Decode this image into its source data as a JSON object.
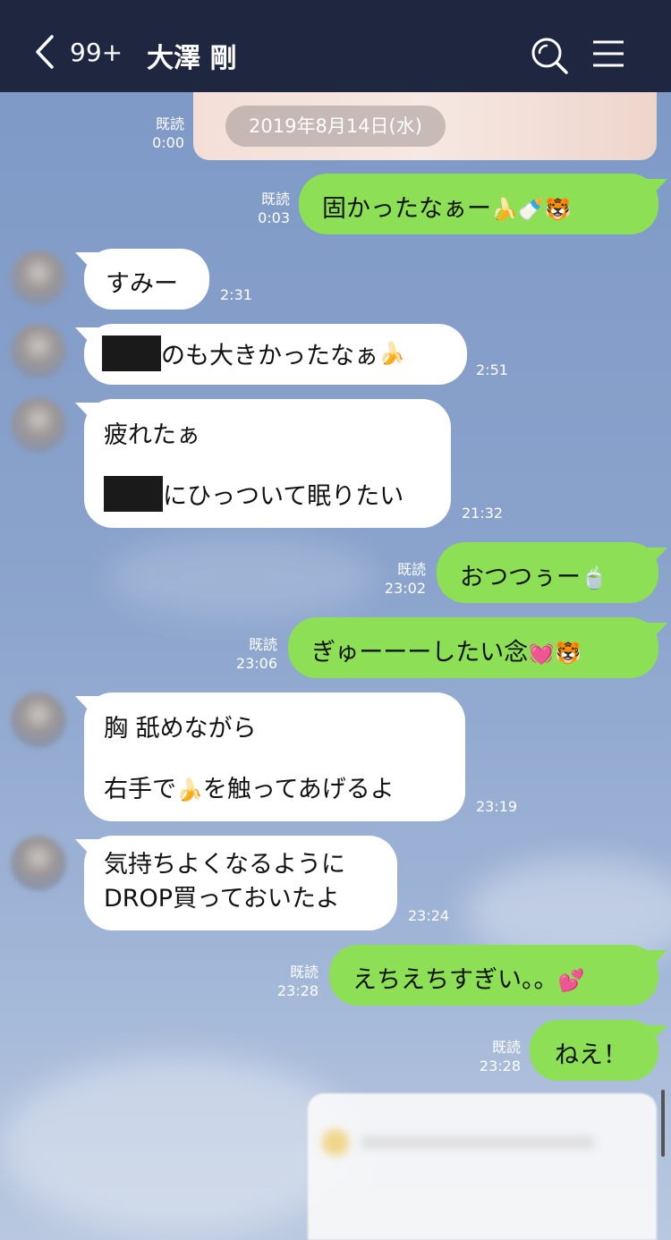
{
  "header": {
    "unread_count": "99+",
    "chat_name": "大澤 剛",
    "back_icon": "chevron-left-icon",
    "search_icon": "search-icon",
    "menu_icon": "hamburger-menu-icon"
  },
  "date_separator": "2019年8月14日(水)",
  "messages": [
    {
      "side": "right",
      "read": "既読",
      "time": "0:00",
      "type": "image"
    },
    {
      "side": "right",
      "read": "既読",
      "time": "0:03",
      "text": "固かったなぁー",
      "emoji": "🍌🍼🐯"
    },
    {
      "side": "left",
      "time": "2:31",
      "text": "すみー"
    },
    {
      "side": "left",
      "time": "2:51",
      "text": "のも大きかったなぁ",
      "emoji": "🍌"
    },
    {
      "side": "left",
      "time": "21:32",
      "line1": "疲れたぁ",
      "line2": "にひっついて眠りたい"
    },
    {
      "side": "right",
      "read": "既読",
      "time": "23:02",
      "text": "おつつぅー",
      "emoji": "🍵"
    },
    {
      "side": "right",
      "read": "既読",
      "time": "23:06",
      "text": "ぎゅーーーしたい念",
      "emoji": "💓🐯"
    },
    {
      "side": "left",
      "time": "23:19",
      "line1": "胸 舐めながら",
      "line2a": "右手で",
      "emoji": "🍌",
      "line2b": "を触ってあげるよ"
    },
    {
      "side": "left",
      "time": "23:24",
      "line1": "気持ちよくなるように",
      "line2": "DROP買っておいたよ"
    },
    {
      "side": "right",
      "read": "既読",
      "time": "23:28",
      "text": "えちえちすぎい。。",
      "emoji": "💕"
    },
    {
      "side": "right",
      "read": "既読",
      "time": "23:28",
      "text": "ねえ！"
    }
  ],
  "colors": {
    "header_bg": "#1f2740",
    "sent_bubble": "#8de055",
    "received_bubble": "#ffffff",
    "chat_bg": "#8aa3cc"
  }
}
